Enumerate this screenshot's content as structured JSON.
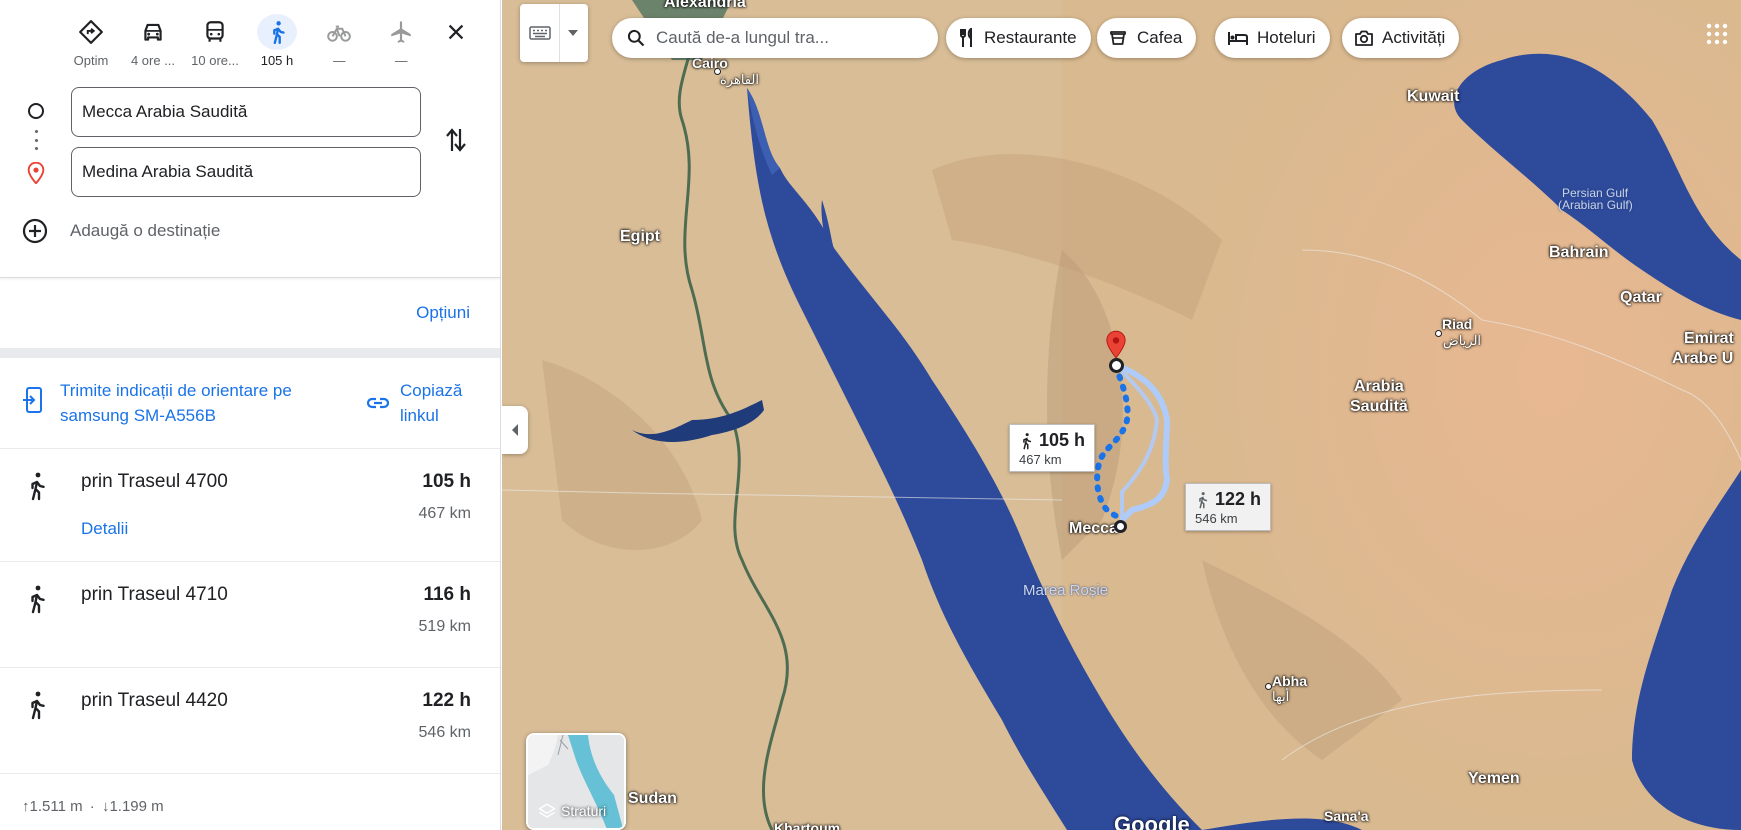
{
  "modes": [
    {
      "name": "Optim",
      "icon": "best-route-icon",
      "state": "normal"
    },
    {
      "name": "4 ore ...",
      "icon": "car-icon",
      "state": "normal"
    },
    {
      "name": "10 ore...",
      "icon": "bus-icon",
      "state": "normal"
    },
    {
      "name": "105 h",
      "icon": "walk-icon",
      "state": "active"
    },
    {
      "name": "—",
      "icon": "bicycle-icon",
      "state": "disabled"
    },
    {
      "name": "—",
      "icon": "airplane-icon",
      "state": "disabled"
    }
  ],
  "directions": {
    "origin": "Mecca Arabia Saudită",
    "destination": "Medina Arabia Saudită",
    "add_destination": "Adaugă o destinație",
    "options": "Opțiuni"
  },
  "share": {
    "send_label": "Trimite indicații de orientare pe samsung SM-A556B",
    "copy_label": "Copiază linkul"
  },
  "routes": [
    {
      "name": "prin Traseul 4700",
      "time": "105 h",
      "distance": "467 km",
      "details": "Detalii"
    },
    {
      "name": "prin Traseul 4710",
      "time": "116 h",
      "distance": "519 km"
    },
    {
      "name": "prin Traseul 4420",
      "time": "122 h",
      "distance": "546 km"
    }
  ],
  "elevation": {
    "up": "1.511 m",
    "down": "1.199 m"
  },
  "map": {
    "search_placeholder": "Caută de-a lungul tra...",
    "chips": [
      "Restaurante",
      "Cafea",
      "Hoteluri",
      "Activități"
    ],
    "layers_label": "Straturi",
    "labels": {
      "alexandria": "Alexandria",
      "cairo": "Cairo",
      "cairo_ar": "القاهرة",
      "egypt": "Egipt",
      "kuwait": "Kuwait",
      "persian_gulf": "Persian Gulf",
      "persian_gulf_2": "(Arabian Gulf)",
      "bahrain": "Bahrain",
      "qatar": "Qatar",
      "emirates_1": "Emirat",
      "emirates_2": "Arabe U",
      "riyadh": "Riad",
      "riyadh_ar": "الرياض",
      "saudi_1": "Arabia",
      "saudi_2": "Saudită",
      "mecca": "Mecca",
      "red_sea": "Marea Roșie",
      "abha": "Abha",
      "abha_ar": "أبها",
      "sudan": "Sudan",
      "yemen": "Yemen",
      "sanaa": "Sana'a",
      "khartoum": "Khartoum",
      "google": "Google"
    },
    "route_labels": [
      {
        "time": "105 h",
        "distance": "467 km"
      },
      {
        "time": "122 h",
        "distance": "546 km"
      }
    ],
    "colors": {
      "route_primary": "#1a73e8",
      "route_alt": "#aecbfa",
      "sea": "#2e4a9a",
      "pin": "#ea4335"
    }
  }
}
